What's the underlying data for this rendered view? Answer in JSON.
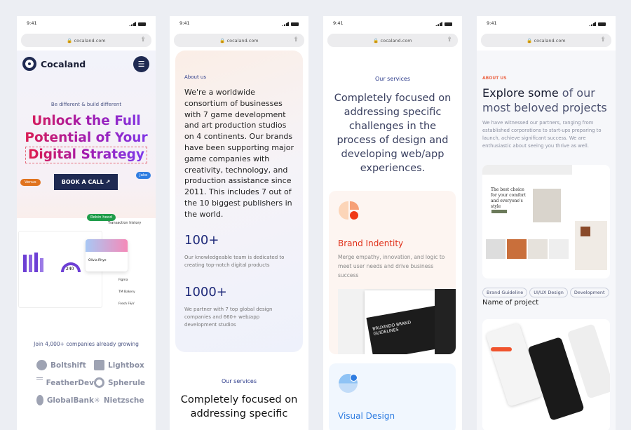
{
  "status": {
    "time": "9:41",
    "url": "cocaland.com"
  },
  "panel1": {
    "brand": "Cocaland",
    "tagline": "Be different & build different",
    "headline": [
      "Unlock the Full",
      "Potential of Your",
      "Digital Strategy"
    ],
    "cta": "BOOK A CALL",
    "cursors": {
      "venus": "Venus",
      "jake": "Jake",
      "robin": "Robin hood"
    },
    "dashboard": {
      "title": "Transaction history",
      "gauge_value": "240",
      "profile_name": "Olivia Rhye",
      "rows": [
        "Figma",
        "TM Bakery",
        "Fresh F&V"
      ]
    },
    "join_text": "Join 4,000+ companies already growing",
    "logos": [
      "Boltshift",
      "Lightbox",
      "FeatherDev",
      "Spherule",
      "GlobalBank",
      "Nietzsche"
    ]
  },
  "panel2": {
    "label": "About us",
    "paragraph": "We're a worldwide consortium of businesses with 7 game development and art production studios on 4 continents. Our brands have been supporting major game companies with creativity, technology, and production assistance since 2011. This includes 7 out of the 10 biggest publishers in the world.",
    "stats": [
      {
        "value": "100+",
        "text": "Our knowledgeable team is dedicated to creating top-notch digital products"
      },
      {
        "value": "1000+",
        "text": "We partner with 7 top global design companies and 660+ web/app development studios"
      }
    ],
    "services_label": "Our services",
    "services_heading": "Completely focused on addressing specific"
  },
  "panel3": {
    "label": "Our services",
    "heading": "Completely focused on addressing specific challenges in the process of design and developing web/app experiences.",
    "cards": [
      {
        "title": "Brand Indentity",
        "text": "Merge empathy, innovation, and logic to meet user needs and drive business success",
        "color": "#e0321b",
        "mock_text": "BRUXINDO BRAND GUIDELINES"
      },
      {
        "title": "Visual Design",
        "color": "#2f7de1"
      }
    ]
  },
  "panel4": {
    "label": "ABOUT US",
    "heading_dark": "Explore some",
    "heading_light": " of our most beloved projects",
    "text": "We have witnessed our partners, ranging from established corporations to start-ups preparing to launch, achieve significant success. We are enthusiastic about seeing you thrive as well.",
    "mock_headline": "The best choice for your comfort and everyone's style",
    "tags": [
      "Brand Guideline",
      "UI/UX Design",
      "Development"
    ],
    "project_name": "Name of project"
  },
  "colors": {
    "navy": "#1f2a52",
    "accent_red": "#e0321b",
    "accent_blue": "#2f7de1",
    "bg": "#eceef3"
  }
}
